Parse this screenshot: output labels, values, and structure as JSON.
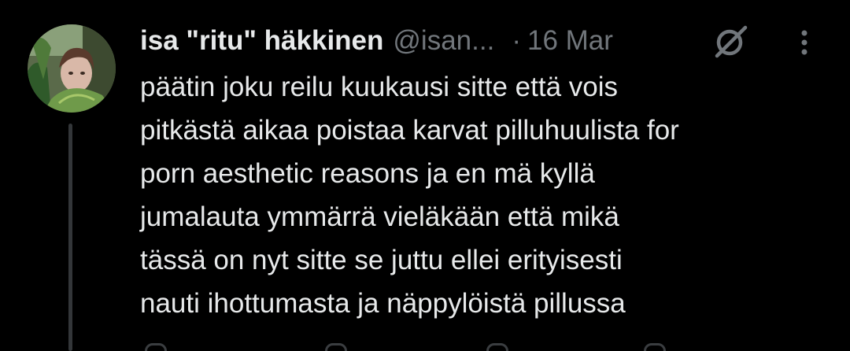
{
  "author": {
    "display_name": "isa \"ritu\" häkkinen",
    "handle": "@isan...",
    "separator": "·",
    "date": "16 Mar"
  },
  "icons": {
    "grok": "grok-icon",
    "more": "more-vertical-icon"
  },
  "tweet": {
    "lines": [
      "päätin joku reilu kuukausi sitte että vois",
      "pitkästä aikaa poistaa karvat pilluhuulista for",
      "porn aesthetic reasons ja en mä kyllä",
      "jumalauta ymmärrä vieläkään että mikä",
      "tässä on nyt sitte se juttu ellei erityisesti",
      "nauti ihottumasta ja näppylöistä pillussa"
    ]
  },
  "colors": {
    "background": "#000000",
    "text": "#e7e9ea",
    "secondary": "#71767b",
    "thread_line": "#333639"
  }
}
